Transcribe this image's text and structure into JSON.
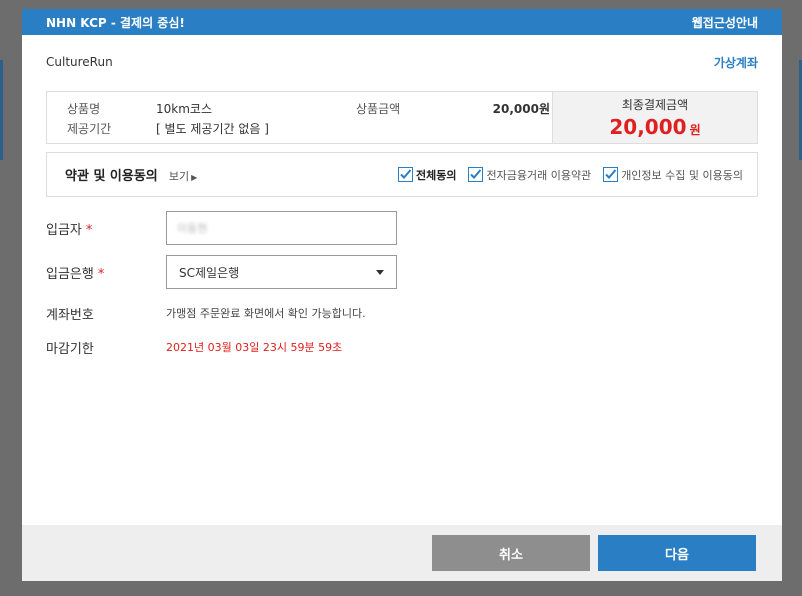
{
  "header": {
    "title": "NHN KCP - 결제의 중심!",
    "accessibility_link": "웹접근성안내"
  },
  "merchant": "CultureRun",
  "payment_method": "가상계좌",
  "summary": {
    "product_label": "상품명",
    "product_value": "10km코스",
    "period_label": "제공기간",
    "period_value": "[ 별도 제공기간 없음 ]",
    "price_label": "상품금액",
    "price_value": "20,000원",
    "final_label": "최종결제금액",
    "final_amount": "20,000",
    "final_unit": "원"
  },
  "terms": {
    "title": "약관 및 이용동의",
    "view_label": "보기",
    "checks": [
      {
        "label": "전체동의",
        "checked": true
      },
      {
        "label": "전자금융거래 이용약관",
        "checked": true
      },
      {
        "label": "개인정보 수집 및 이용동의",
        "checked": true
      }
    ]
  },
  "form": {
    "depositor_label": "입금자",
    "depositor_value": "이동현",
    "bank_label": "입금은행",
    "bank_value": "SC제일은행",
    "account_label": "계좌번호",
    "account_note": "가맹점 주문완료 화면에서 확인 가능합니다.",
    "deadline_label": "마감기한",
    "deadline_value": "2021년 03월 03일 23시 59분 59초",
    "required_mark": "*"
  },
  "buttons": {
    "cancel": "취소",
    "next": "다음"
  },
  "colors": {
    "accent": "#2a7fc4",
    "danger": "#e02020",
    "cancel_button": "#8e8e8e"
  }
}
